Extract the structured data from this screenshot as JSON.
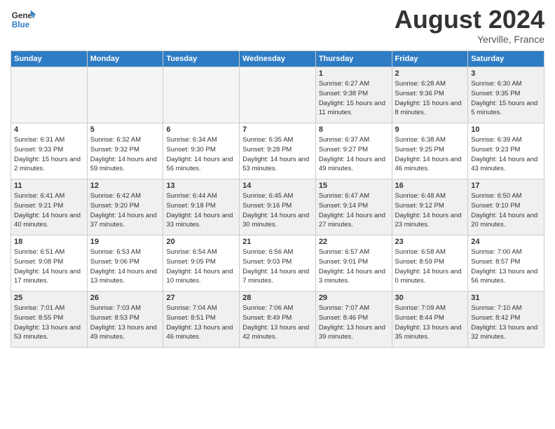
{
  "header": {
    "logo_line1": "General",
    "logo_line2": "Blue",
    "month": "August 2024",
    "location": "Yerville, France"
  },
  "weekdays": [
    "Sunday",
    "Monday",
    "Tuesday",
    "Wednesday",
    "Thursday",
    "Friday",
    "Saturday"
  ],
  "weeks": [
    [
      {
        "day": "",
        "sunrise": "",
        "sunset": "",
        "daylight": "",
        "empty": true
      },
      {
        "day": "",
        "sunrise": "",
        "sunset": "",
        "daylight": "",
        "empty": true
      },
      {
        "day": "",
        "sunrise": "",
        "sunset": "",
        "daylight": "",
        "empty": true
      },
      {
        "day": "",
        "sunrise": "",
        "sunset": "",
        "daylight": "",
        "empty": true
      },
      {
        "day": "1",
        "sunrise": "Sunrise: 6:27 AM",
        "sunset": "Sunset: 9:38 PM",
        "daylight": "Daylight: 15 hours and 11 minutes.",
        "empty": false
      },
      {
        "day": "2",
        "sunrise": "Sunrise: 6:28 AM",
        "sunset": "Sunset: 9:36 PM",
        "daylight": "Daylight: 15 hours and 8 minutes.",
        "empty": false
      },
      {
        "day": "3",
        "sunrise": "Sunrise: 6:30 AM",
        "sunset": "Sunset: 9:35 PM",
        "daylight": "Daylight: 15 hours and 5 minutes.",
        "empty": false
      }
    ],
    [
      {
        "day": "4",
        "sunrise": "Sunrise: 6:31 AM",
        "sunset": "Sunset: 9:33 PM",
        "daylight": "Daylight: 15 hours and 2 minutes.",
        "empty": false
      },
      {
        "day": "5",
        "sunrise": "Sunrise: 6:32 AM",
        "sunset": "Sunset: 9:32 PM",
        "daylight": "Daylight: 14 hours and 59 minutes.",
        "empty": false
      },
      {
        "day": "6",
        "sunrise": "Sunrise: 6:34 AM",
        "sunset": "Sunset: 9:30 PM",
        "daylight": "Daylight: 14 hours and 56 minutes.",
        "empty": false
      },
      {
        "day": "7",
        "sunrise": "Sunrise: 6:35 AM",
        "sunset": "Sunset: 9:28 PM",
        "daylight": "Daylight: 14 hours and 53 minutes.",
        "empty": false
      },
      {
        "day": "8",
        "sunrise": "Sunrise: 6:37 AM",
        "sunset": "Sunset: 9:27 PM",
        "daylight": "Daylight: 14 hours and 49 minutes.",
        "empty": false
      },
      {
        "day": "9",
        "sunrise": "Sunrise: 6:38 AM",
        "sunset": "Sunset: 9:25 PM",
        "daylight": "Daylight: 14 hours and 46 minutes.",
        "empty": false
      },
      {
        "day": "10",
        "sunrise": "Sunrise: 6:39 AM",
        "sunset": "Sunset: 9:23 PM",
        "daylight": "Daylight: 14 hours and 43 minutes.",
        "empty": false
      }
    ],
    [
      {
        "day": "11",
        "sunrise": "Sunrise: 6:41 AM",
        "sunset": "Sunset: 9:21 PM",
        "daylight": "Daylight: 14 hours and 40 minutes.",
        "empty": false
      },
      {
        "day": "12",
        "sunrise": "Sunrise: 6:42 AM",
        "sunset": "Sunset: 9:20 PM",
        "daylight": "Daylight: 14 hours and 37 minutes.",
        "empty": false
      },
      {
        "day": "13",
        "sunrise": "Sunrise: 6:44 AM",
        "sunset": "Sunset: 9:18 PM",
        "daylight": "Daylight: 14 hours and 33 minutes.",
        "empty": false
      },
      {
        "day": "14",
        "sunrise": "Sunrise: 6:45 AM",
        "sunset": "Sunset: 9:16 PM",
        "daylight": "Daylight: 14 hours and 30 minutes.",
        "empty": false
      },
      {
        "day": "15",
        "sunrise": "Sunrise: 6:47 AM",
        "sunset": "Sunset: 9:14 PM",
        "daylight": "Daylight: 14 hours and 27 minutes.",
        "empty": false
      },
      {
        "day": "16",
        "sunrise": "Sunrise: 6:48 AM",
        "sunset": "Sunset: 9:12 PM",
        "daylight": "Daylight: 14 hours and 23 minutes.",
        "empty": false
      },
      {
        "day": "17",
        "sunrise": "Sunrise: 6:50 AM",
        "sunset": "Sunset: 9:10 PM",
        "daylight": "Daylight: 14 hours and 20 minutes.",
        "empty": false
      }
    ],
    [
      {
        "day": "18",
        "sunrise": "Sunrise: 6:51 AM",
        "sunset": "Sunset: 9:08 PM",
        "daylight": "Daylight: 14 hours and 17 minutes.",
        "empty": false
      },
      {
        "day": "19",
        "sunrise": "Sunrise: 6:53 AM",
        "sunset": "Sunset: 9:06 PM",
        "daylight": "Daylight: 14 hours and 13 minutes.",
        "empty": false
      },
      {
        "day": "20",
        "sunrise": "Sunrise: 6:54 AM",
        "sunset": "Sunset: 9:05 PM",
        "daylight": "Daylight: 14 hours and 10 minutes.",
        "empty": false
      },
      {
        "day": "21",
        "sunrise": "Sunrise: 6:56 AM",
        "sunset": "Sunset: 9:03 PM",
        "daylight": "Daylight: 14 hours and 7 minutes.",
        "empty": false
      },
      {
        "day": "22",
        "sunrise": "Sunrise: 6:57 AM",
        "sunset": "Sunset: 9:01 PM",
        "daylight": "Daylight: 14 hours and 3 minutes.",
        "empty": false
      },
      {
        "day": "23",
        "sunrise": "Sunrise: 6:58 AM",
        "sunset": "Sunset: 8:59 PM",
        "daylight": "Daylight: 14 hours and 0 minutes.",
        "empty": false
      },
      {
        "day": "24",
        "sunrise": "Sunrise: 7:00 AM",
        "sunset": "Sunset: 8:57 PM",
        "daylight": "Daylight: 13 hours and 56 minutes.",
        "empty": false
      }
    ],
    [
      {
        "day": "25",
        "sunrise": "Sunrise: 7:01 AM",
        "sunset": "Sunset: 8:55 PM",
        "daylight": "Daylight: 13 hours and 53 minutes.",
        "empty": false
      },
      {
        "day": "26",
        "sunrise": "Sunrise: 7:03 AM",
        "sunset": "Sunset: 8:53 PM",
        "daylight": "Daylight: 13 hours and 49 minutes.",
        "empty": false
      },
      {
        "day": "27",
        "sunrise": "Sunrise: 7:04 AM",
        "sunset": "Sunset: 8:51 PM",
        "daylight": "Daylight: 13 hours and 46 minutes.",
        "empty": false
      },
      {
        "day": "28",
        "sunrise": "Sunrise: 7:06 AM",
        "sunset": "Sunset: 8:49 PM",
        "daylight": "Daylight: 13 hours and 42 minutes.",
        "empty": false
      },
      {
        "day": "29",
        "sunrise": "Sunrise: 7:07 AM",
        "sunset": "Sunset: 8:46 PM",
        "daylight": "Daylight: 13 hours and 39 minutes.",
        "empty": false
      },
      {
        "day": "30",
        "sunrise": "Sunrise: 7:09 AM",
        "sunset": "Sunset: 8:44 PM",
        "daylight": "Daylight: 13 hours and 35 minutes.",
        "empty": false
      },
      {
        "day": "31",
        "sunrise": "Sunrise: 7:10 AM",
        "sunset": "Sunset: 8:42 PM",
        "daylight": "Daylight: 13 hours and 32 minutes.",
        "empty": false
      }
    ]
  ]
}
